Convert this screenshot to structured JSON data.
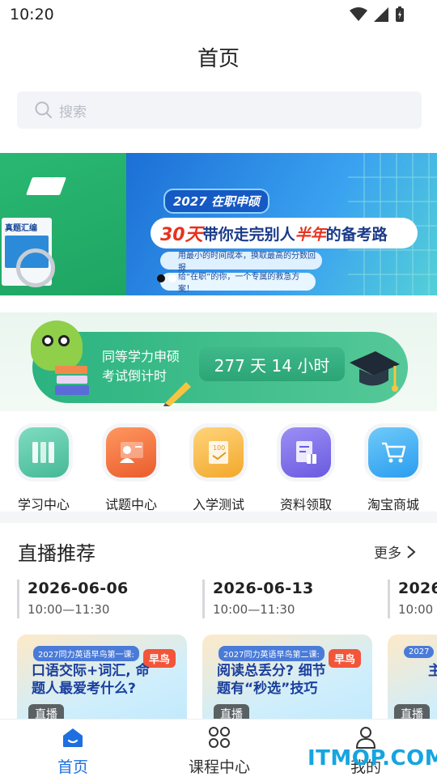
{
  "status_bar": {
    "time": "10:20"
  },
  "header": {
    "title": "首页"
  },
  "search": {
    "placeholder": "搜索"
  },
  "banner": {
    "tag": "2027 在职申硕",
    "headline_red": "30天",
    "headline_mid": "带你走完别人",
    "headline_red2": "半年",
    "headline_end": "的备考路",
    "sub1": "用最小的时间成本，换取最高的分数回报",
    "sub2": "给“在职”的你，一个专属的救急方案！",
    "book_title": "真题汇编"
  },
  "countdown": {
    "label_line1": "同等学力申硕",
    "label_line2": "考试倒计时",
    "value": "277 天 14 小时"
  },
  "quick_nav": [
    {
      "label": "学习中心",
      "icon": "books-icon",
      "color": "#5cc9a7"
    },
    {
      "label": "试题中心",
      "icon": "teacher-icon",
      "color": "#f0703e"
    },
    {
      "label": "入学测试",
      "icon": "test-paper-icon",
      "color": "#f5b942"
    },
    {
      "label": "资料领取",
      "icon": "document-gift-icon",
      "color": "#7a6ce8"
    },
    {
      "label": "淘宝商城",
      "icon": "shopping-cart-icon",
      "color": "#2fa8f0"
    }
  ],
  "live_section": {
    "title": "直播推荐",
    "more": "更多",
    "dates": [
      {
        "date": "2026-06-06",
        "time": "10:00—11:30"
      },
      {
        "date": "2026-06-13",
        "time": "10:00—11:30"
      },
      {
        "date": "2026",
        "time": "10:00"
      }
    ],
    "cards": [
      {
        "tag": "2027同力英语早鸟第一课:",
        "headline": "口语交际+词汇, 命题人最爱考什么?",
        "badge": "早鸟",
        "live": "直播"
      },
      {
        "tag": "2027同力英语早鸟第二课:",
        "headline": "阅读总丢分? 细节题有“秒选”技巧",
        "badge": "早鸟",
        "live": "直播"
      },
      {
        "tag": "2027",
        "headline": "主",
        "badge": "",
        "live": "直播"
      }
    ]
  },
  "tab_bar": [
    {
      "label": "首页",
      "icon": "home-icon",
      "active": true
    },
    {
      "label": "课程中心",
      "icon": "grid-icon",
      "active": false
    },
    {
      "label": "我的",
      "icon": "person-icon",
      "active": false
    }
  ],
  "watermark": "ITMOP.COM",
  "colors": {
    "accent": "#1e6fe0",
    "countdown_green": "#2ca576"
  }
}
